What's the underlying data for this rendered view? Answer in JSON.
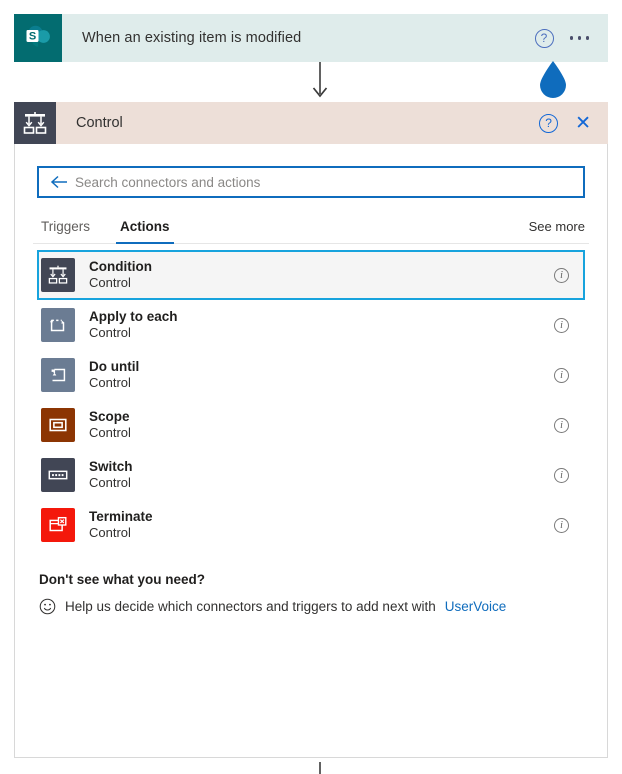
{
  "trigger": {
    "title": "When an existing item is modified",
    "icon": "sharepoint-icon",
    "help_label": "?",
    "menu_label": "more-options",
    "bg_color": "#dfeceb",
    "icon_bg": "#036c70"
  },
  "cursor": {
    "icon": "blue-drop-cursor",
    "color": "#0f6cbd"
  },
  "panel": {
    "title": "Control",
    "icon": "control-icon",
    "header_bg": "#eddfd8",
    "icon_bg": "#414655",
    "help_label": "?",
    "close_label": "✕"
  },
  "search": {
    "placeholder": "Search connectors and actions",
    "value": "",
    "back_icon": "back-arrow-icon",
    "accent": "#0f6cbd"
  },
  "tabs": {
    "items": [
      {
        "label": "Triggers",
        "active": false
      },
      {
        "label": "Actions",
        "active": true
      }
    ],
    "see_more": "See more"
  },
  "actions": {
    "items": [
      {
        "title": "Condition",
        "subtitle": "Control",
        "icon": "condition-icon",
        "icon_bg": "#414655",
        "selected": true,
        "info": "i"
      },
      {
        "title": "Apply to each",
        "subtitle": "Control",
        "icon": "apply-to-each-icon",
        "icon_bg": "#6b7c93",
        "selected": false,
        "info": "i"
      },
      {
        "title": "Do until",
        "subtitle": "Control",
        "icon": "do-until-icon",
        "icon_bg": "#6b7c93",
        "selected": false,
        "info": "i"
      },
      {
        "title": "Scope",
        "subtitle": "Control",
        "icon": "scope-icon",
        "icon_bg": "#8c3503",
        "selected": false,
        "info": "i"
      },
      {
        "title": "Switch",
        "subtitle": "Control",
        "icon": "switch-icon",
        "icon_bg": "#414655",
        "selected": false,
        "info": "i"
      },
      {
        "title": "Terminate",
        "subtitle": "Control",
        "icon": "terminate-icon",
        "icon_bg": "#f4180b",
        "selected": false,
        "info": "i"
      }
    ],
    "selection_color": "#17a3dd"
  },
  "footer": {
    "title": "Don't see what you need?",
    "icon": "smiley-icon",
    "text_before": "Help us decide which connectors and triggers to add next with",
    "link_label": "UserVoice"
  }
}
